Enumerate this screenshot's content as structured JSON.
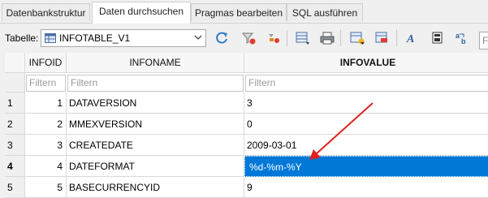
{
  "tabs": [
    {
      "label": "Datenbankstruktur",
      "active": false
    },
    {
      "label": "Daten durchsuchen",
      "active": true
    },
    {
      "label": "Pragmas bearbeiten",
      "active": false
    },
    {
      "label": "SQL ausführen",
      "active": false
    }
  ],
  "toolbar": {
    "table_label": "Tabelle:",
    "table_value": "INFOTABLE_V1",
    "filter_placeholder": "Fi"
  },
  "icons": [
    "table-icon",
    "refresh-icon",
    "clear-filter-icon",
    "clear-sort-icon",
    "save-table-icon",
    "print-icon",
    "new-record-icon",
    "delete-record-icon",
    "font-icon",
    "set-as-null-icon",
    "find-replace-icon"
  ],
  "columns": [
    "INFOID",
    "INFONAME",
    "INFOVALUE"
  ],
  "filter_placeholder": "Filtern",
  "rows": [
    {
      "row": "1",
      "id": "1",
      "name": "DATAVERSION",
      "value": "3"
    },
    {
      "row": "2",
      "id": "2",
      "name": "MMEXVERSION",
      "value": "0"
    },
    {
      "row": "3",
      "id": "3",
      "name": "CREATEDATE",
      "value": "2009-03-01"
    },
    {
      "row": "4",
      "id": "4",
      "name": "DATEFORMAT",
      "value": "%d-%m-%Y"
    },
    {
      "row": "5",
      "id": "5",
      "name": "BASECURRENCYID",
      "value": "9"
    }
  ],
  "selection": {
    "row": "4",
    "column": "INFOVALUE"
  },
  "colors": {
    "selection": "#0078d7",
    "annotation_arrow": "#e02020"
  }
}
